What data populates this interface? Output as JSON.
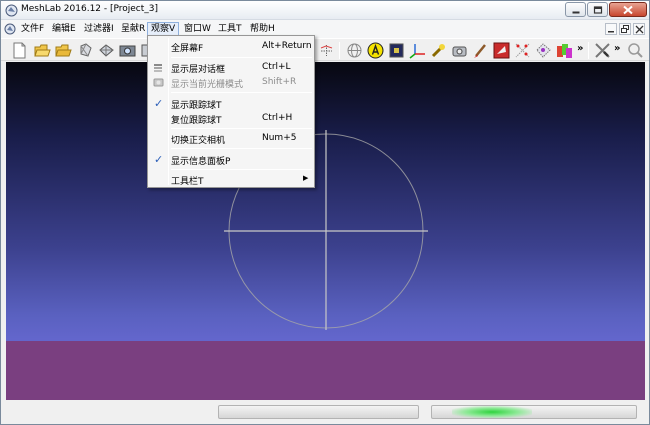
{
  "window": {
    "title": "MeshLab 2016.12 - [Project_3]"
  },
  "menubar": {
    "items": [
      "文件F",
      "编辑E",
      "过滤器I",
      "呈献R",
      "观察V",
      "窗口W",
      "工具T",
      "帮助H"
    ],
    "active_index": 4
  },
  "toolbar": {
    "more_glyph": "»"
  },
  "view_menu": {
    "items": [
      {
        "label": "全屏幕F",
        "shortcut": "Alt+Return",
        "checked": false,
        "enabled": true,
        "icon": "none"
      },
      {
        "label": "显示层对话框",
        "shortcut": "Ctrl+L",
        "checked": false,
        "enabled": true,
        "icon": "layers-icon"
      },
      {
        "label": "显示当前光栅模式",
        "shortcut": "Shift+R",
        "checked": false,
        "enabled": false,
        "icon": "raster-icon"
      },
      {
        "label": "显示跟踪球T",
        "shortcut": "",
        "checked": true,
        "enabled": true,
        "icon": "none"
      },
      {
        "label": "复位跟踪球T",
        "shortcut": "Ctrl+H",
        "checked": false,
        "enabled": true,
        "icon": "none"
      },
      {
        "label": "切换正交相机",
        "shortcut": "Num+5",
        "checked": false,
        "enabled": true,
        "icon": "none"
      },
      {
        "label": "显示信息面板P",
        "shortcut": "",
        "checked": true,
        "enabled": true,
        "icon": "none"
      },
      {
        "label": "工具栏T",
        "shortcut": "",
        "checked": false,
        "enabled": true,
        "submenu": true,
        "icon": "none"
      }
    ],
    "check_glyph": "✓",
    "submenu_glyph": "▶"
  },
  "colors": {
    "viewport_top": "#07070f",
    "viewport_bottom": "#6366cc",
    "floor": "#7a3f80",
    "trackball": "#a7a7a7",
    "progress_glow": "#2fd33e"
  }
}
